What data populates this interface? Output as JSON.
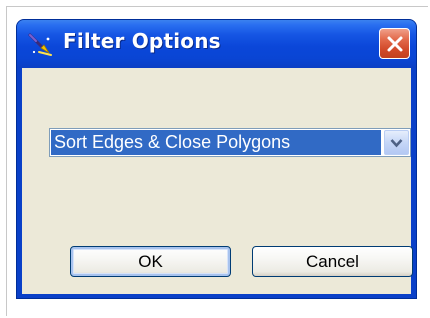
{
  "dialog": {
    "title": "Filter Options",
    "icon": "wand-icon",
    "close_icon": "close-icon"
  },
  "filter_select": {
    "selected": "Sort Edges & Close Polygons",
    "arrow_icon": "chevron-down-icon"
  },
  "buttons": {
    "ok_label": "OK",
    "cancel_label": "Cancel"
  },
  "colors": {
    "title_bar": "#0b47d9",
    "close_button": "#d24a2a",
    "selection": "#316ac5",
    "client": "#ece9d8"
  }
}
